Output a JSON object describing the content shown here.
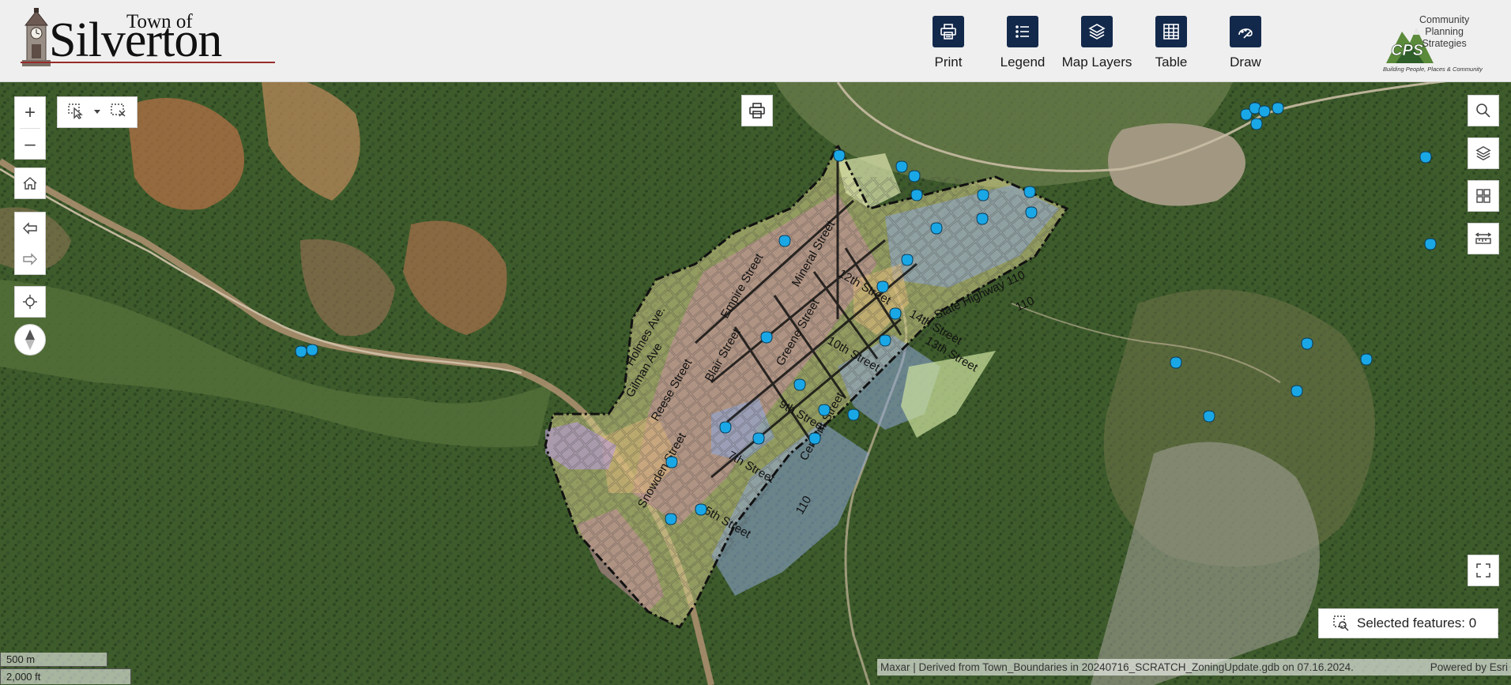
{
  "header": {
    "logo": {
      "small": "Town of",
      "big": "Silverton"
    },
    "toolbar": [
      {
        "id": "print",
        "label": "Print",
        "icon": "print-icon"
      },
      {
        "id": "legend",
        "label": "Legend",
        "icon": "list-icon"
      },
      {
        "id": "layers",
        "label": "Map Layers",
        "icon": "layers-icon"
      },
      {
        "id": "table",
        "label": "Table",
        "icon": "table-icon"
      },
      {
        "id": "draw",
        "label": "Draw",
        "icon": "draw-icon"
      }
    ],
    "partner_logo": {
      "line1": "Community",
      "line2": "Planning",
      "line3": "Strategies",
      "mark": "CPS",
      "tagline": "Building People, Places & Community"
    }
  },
  "map": {
    "zoom_in": "+",
    "zoom_out": "–",
    "streets": [
      "Holmes Ave.",
      "Gilman Ave",
      "Reese Street",
      "Blair Street",
      "Greene Street",
      "Snowden Street",
      "Mineral Street",
      "Cement Street",
      "5th Street",
      "State Highway 110",
      "110",
      "14th Street",
      "13th Street",
      "12th Street",
      "10th Street",
      "7th Street",
      "9th Street",
      "Empire Street",
      "110"
    ],
    "selected_features": "Selected features: 0",
    "scale": {
      "metric": "500 m",
      "imperial": "2,000 ft"
    },
    "attribution": "Maxar | Derived from Town_Boundaries in 20240716_SCRATCH_ZoningUpdate.gdb on 07.16.2024.",
    "powered_by": "Powered by Esri"
  },
  "colors": {
    "toolbar_button": "#13294b",
    "zone_commercial": "#c98ea0",
    "zone_residential": "#d8d28c",
    "zone_public": "#8ea6d8",
    "zone_mixed": "#dcb77a",
    "zone_purple": "#b79bd6",
    "marker": "#1aa7e6"
  }
}
